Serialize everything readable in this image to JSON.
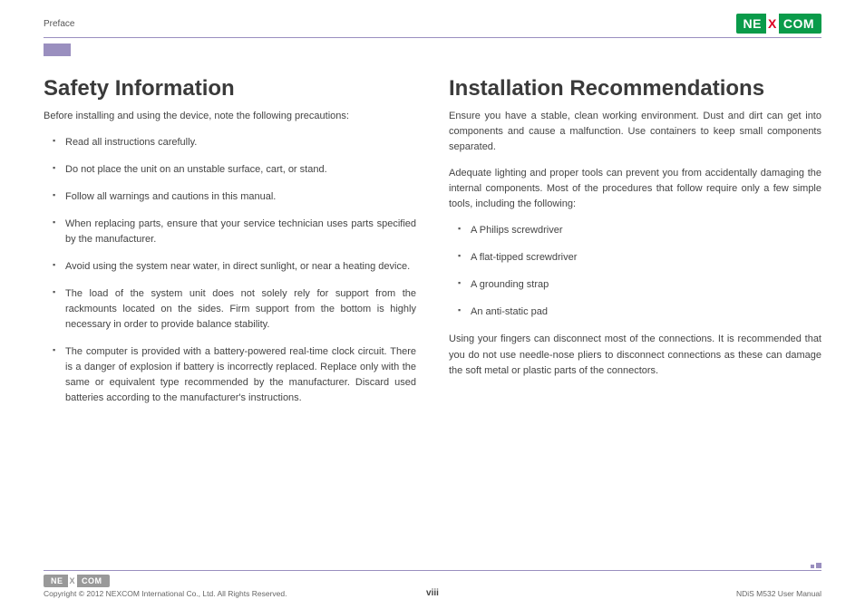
{
  "header": {
    "section": "Preface",
    "brand_left": "NE",
    "brand_x": "X",
    "brand_right": "COM"
  },
  "left": {
    "title": "Safety Information",
    "intro": "Before installing and using the device, note the following precautions:",
    "items": [
      "Read all instructions carefully.",
      "Do not place the unit on an unstable surface, cart, or stand.",
      "Follow all warnings and cautions in this manual.",
      "When replacing parts, ensure that your service technician uses parts specified by the manufacturer.",
      "Avoid using the system near water, in direct sunlight, or near a heating device.",
      "The load of the system unit does not solely rely for support from the rackmounts located on the sides. Firm support from the bottom is highly necessary in order to provide balance stability.",
      "The computer is provided with a battery-powered real-time clock circuit. There is a danger of explosion if battery is incorrectly replaced. Replace only with the same or equivalent type recommended by the manufacturer. Discard used batteries according to the manufacturer's instructions."
    ]
  },
  "right": {
    "title": "Installation Recommendations",
    "p1": "Ensure you have a stable, clean working environment. Dust and dirt can get into components and cause a malfunction. Use containers to keep small components separated.",
    "p2": "Adequate lighting and proper tools can prevent you from accidentally damaging the internal components. Most of the procedures that follow require only a few simple tools, including the following:",
    "items": [
      "A Philips screwdriver",
      "A flat-tipped screwdriver",
      "A grounding strap",
      "An anti-static pad"
    ],
    "p3": "Using your fingers can disconnect most of the connections. It is recommended that you do not use needle-nose pliers to disconnect connections as these can damage the soft metal or plastic parts of the connectors."
  },
  "footer": {
    "copyright": "Copyright © 2012 NEXCOM International Co., Ltd. All Rights Reserved.",
    "page": "viii",
    "doc": "NDiS M532 User Manual"
  }
}
